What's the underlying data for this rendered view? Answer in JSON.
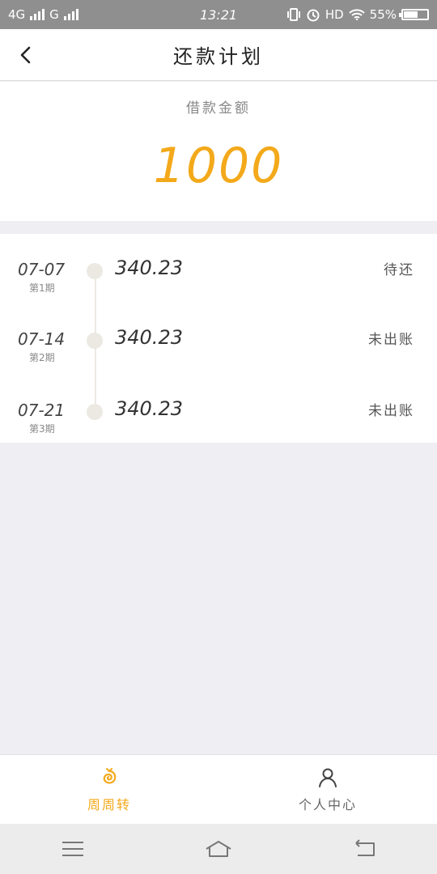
{
  "status_bar": {
    "network_1": "4G",
    "network_2": "G",
    "time": "13:21",
    "hd": "HD",
    "battery": "55%"
  },
  "header": {
    "title": "还款计划",
    "back_icon": "chevron-left-icon"
  },
  "loan": {
    "label": "借款金额",
    "amount": "1000"
  },
  "plan": {
    "items": [
      {
        "date": "07-07",
        "period": "第1期",
        "amount": "340.23",
        "status": "待还"
      },
      {
        "date": "07-14",
        "period": "第2期",
        "amount": "340.23",
        "status": "未出账"
      },
      {
        "date": "07-21",
        "period": "第3期",
        "amount": "340.23",
        "status": "未出账"
      }
    ]
  },
  "tabs": {
    "home": {
      "label": "周周转",
      "icon": "swirl-icon"
    },
    "profile": {
      "label": "个人中心",
      "icon": "person-icon"
    }
  },
  "colors": {
    "accent": "#f3a91a",
    "status_bar": "#8f8f8f",
    "background": "#efeff3"
  }
}
